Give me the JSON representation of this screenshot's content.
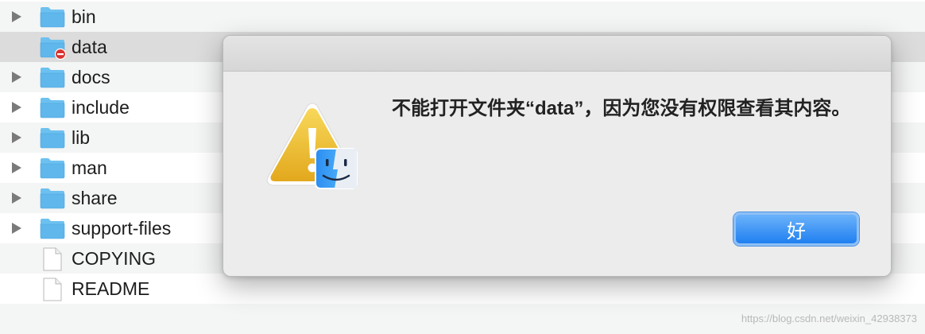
{
  "finder": {
    "items": [
      {
        "label": "bin",
        "type": "folder",
        "disclosure": true
      },
      {
        "label": "data",
        "type": "folder-restricted",
        "disclosure": false
      },
      {
        "label": "docs",
        "type": "folder",
        "disclosure": true
      },
      {
        "label": "include",
        "type": "folder",
        "disclosure": true
      },
      {
        "label": "lib",
        "type": "folder",
        "disclosure": true
      },
      {
        "label": "man",
        "type": "folder",
        "disclosure": true
      },
      {
        "label": "share",
        "type": "folder",
        "disclosure": true
      },
      {
        "label": "support-files",
        "type": "folder",
        "disclosure": true
      },
      {
        "label": "COPYING",
        "type": "document",
        "disclosure": false
      },
      {
        "label": "README",
        "type": "document",
        "disclosure": false
      }
    ]
  },
  "dialog": {
    "message": "不能打开文件夹“data”，因为您没有权限查看其内容。",
    "ok_label": "好",
    "icon": "warning-finder-icon"
  },
  "colors": {
    "accent": "#1f7ff0",
    "folder": "#5fb7ec",
    "selected_row": "#dcdcdc",
    "restricted_badge": "#d9322f"
  },
  "watermark": "https://blog.csdn.net/weixin_42938373"
}
